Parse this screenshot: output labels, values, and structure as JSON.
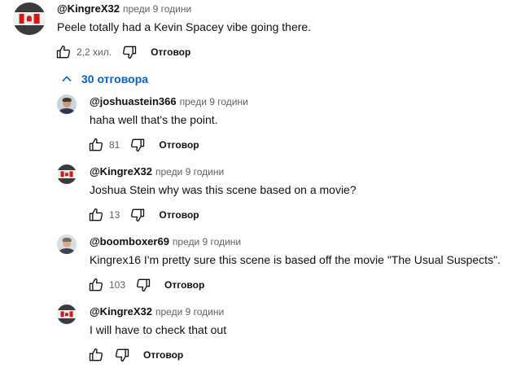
{
  "top_comment": {
    "author": "@KingreX32",
    "time": "преди 9 години",
    "text": "Peele totally had a Kevin Spacey vibe going there.",
    "likes": "2,2 хил.",
    "reply_label": "Отговор",
    "avatar_icon": "canada-flag-avatar"
  },
  "replies_toggle": {
    "label": "30 отговора",
    "icon": "chevron-up-icon",
    "color": "#065fd4"
  },
  "replies": [
    {
      "author": "@joshuastein366",
      "time": "преди 9 години",
      "text": "haha well that's the point.",
      "likes": "81",
      "reply_label": "Отговор",
      "avatar_icon": "person-avatar"
    },
    {
      "author": "@KingreX32",
      "time": "преди 9 години",
      "text": "Joshua Stein why was this scene based on a movie?",
      "likes": "13",
      "reply_label": "Отговор",
      "avatar_icon": "canada-flag-avatar"
    },
    {
      "author": "@boomboxer69",
      "time": "преди 9 години",
      "text": "Kingrex16 I'm pretty sure this scene is based off the movie \"The Usual Suspects\".",
      "likes": "103",
      "reply_label": "Отговор",
      "avatar_icon": "person-avatar"
    },
    {
      "author": "@KingreX32",
      "time": "преди 9 години",
      "text": "I will have to check that out",
      "likes": "",
      "reply_label": "Отговор",
      "avatar_icon": "canada-flag-avatar"
    }
  ]
}
